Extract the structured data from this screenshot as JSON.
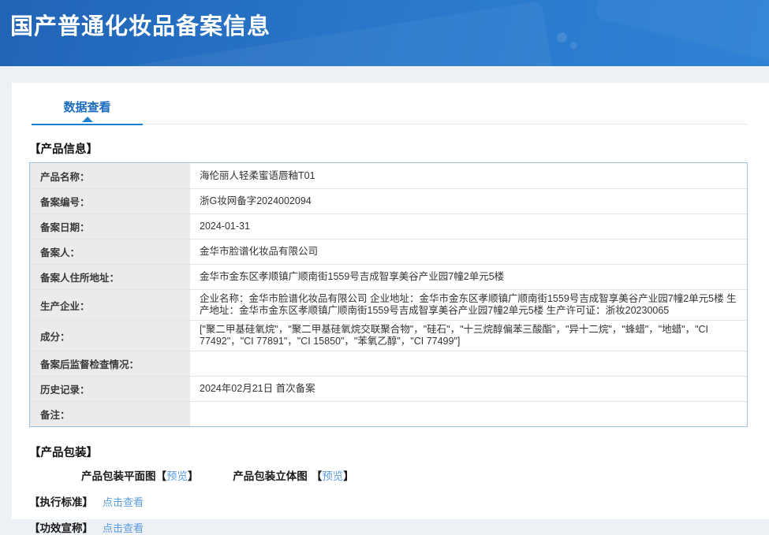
{
  "header": {
    "title": "国产普通化妆品备案信息"
  },
  "tabs": {
    "data_view": "数据查看"
  },
  "product_info": {
    "section_title": "【产品信息】",
    "rows": [
      {
        "label": "产品名称：",
        "value": "海伦丽人轻柔蜜语唇釉T01"
      },
      {
        "label": "备案编号：",
        "value": "浙G妆网备字2024002094"
      },
      {
        "label": "备案日期：",
        "value": "2024-01-31"
      },
      {
        "label": "备案人：",
        "value": "金华市脸谱化妆品有限公司"
      },
      {
        "label": "备案人住所地址：",
        "value": "金华市金东区孝顺镇广顺南街1559号吉成智享美谷产业园7幢2单元5楼"
      },
      {
        "label": "生产企业：",
        "value": "企业名称：金华市脸谱化妆品有限公司 企业地址：金华市金东区孝顺镇广顺南街1559号吉成智享美谷产业园7幢2单元5楼 生产地址：金华市金东区孝顺镇广顺南街1559号吉成智享美谷产业园7幢2单元5楼 生产许可证：浙妆20230065"
      },
      {
        "label": "成分：",
        "value": "[\"聚二甲基硅氧烷\"，\"聚二甲基硅氧烷交联聚合物\"，\"硅石\"，\"十三烷醇偏苯三酸酯\"，\"异十二烷\"，\"蜂蜡\"，\"地蜡\"，\"CI 77492\"，\"CI 77891\"，\"CI 15850\"，\"苯氧乙醇\"，\"CI 77499\"]"
      },
      {
        "label": "备案后监督检查情况：",
        "value": ""
      },
      {
        "label": "历史记录：",
        "value": "2024年02月21日 首次备案"
      },
      {
        "label": "备注：",
        "value": ""
      }
    ]
  },
  "packaging": {
    "section_title": "【产品包装】",
    "items": [
      {
        "label": "产品包装平面图",
        "bracket_open": "【",
        "link": "预览",
        "bracket_close": "】"
      },
      {
        "label": "产品包装立体图",
        "bracket_open": "【",
        "link": "预览",
        "bracket_close": "】"
      }
    ]
  },
  "standard": {
    "label": "【执行标准】",
    "link": "点击查看"
  },
  "efficacy": {
    "label": "【功效宣称】",
    "link": "点击查看"
  },
  "colors": {
    "header_gradient_start": "#2164b6",
    "header_gradient_end": "#2e82d5",
    "tab_accent": "#2080d0",
    "link_blue": "#5b9de0",
    "table_border": "#a0c2e2",
    "label_cell_bg": "#ebebeb",
    "page_bg": "#edf0f4"
  }
}
